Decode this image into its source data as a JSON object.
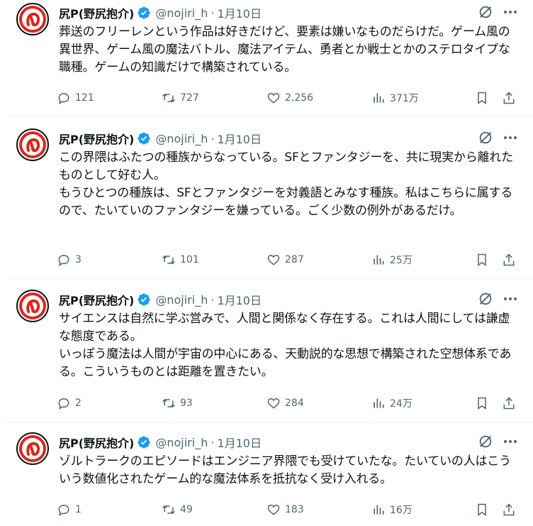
{
  "colors": {
    "text": "#0f1419",
    "muted": "#536471",
    "verified": "#1d9bf0",
    "avatar_red": "#e0251b",
    "divider": "#eff3f4"
  },
  "tweets": [
    {
      "name": "尻P(野尻抱介)",
      "handle": "@nojiri_h",
      "dot": "·",
      "date": "1月10日",
      "text": "葬送のフリーレンという作品は好きだけど、要素は嫌いなものだらけだ。ゲーム風の異世界、ゲーム風の魔法バトル、魔法アイテム、勇者とか戦士とかのステロタイプな職種。ゲームの知識だけで構築されている。",
      "replies": "121",
      "retweets": "727",
      "likes": "2,256",
      "views": "371万"
    },
    {
      "name": "尻P(野尻抱介)",
      "handle": "@nojiri_h",
      "dot": "·",
      "date": "1月10日",
      "text": "この界隈はふたつの種族からなっている。SFとファンタジーを、共に現実から離れたものとして好む人。\nもうひとつの種族は、SFとファンタジーを対義語とみなす種族。私はこちらに属するので、たいていのファンタジーを嫌っている。ごく少数の例外があるだけ。",
      "replies": "3",
      "retweets": "101",
      "likes": "287",
      "views": "25万"
    },
    {
      "name": "尻P(野尻抱介)",
      "handle": "@nojiri_h",
      "dot": "·",
      "date": "1月10日",
      "text": "サイエンスは自然に学ぶ営みで、人間と関係なく存在する。これは人間にしては謙虚な態度である。\nいっぽう魔法は人間が宇宙の中心にある、天動説的な思想で構築された空想体系である。こういうものとは距離を置きたい。",
      "replies": "2",
      "retweets": "93",
      "likes": "284",
      "views": "24万"
    },
    {
      "name": "尻P(野尻抱介)",
      "handle": "@nojiri_h",
      "dot": "·",
      "date": "1月10日",
      "text": "ゾルトラークのエピソードはエンジニア界隈でも受けていたな。たいていの人はこういう数値化されたゲーム的な魔法体系を抵抗なく受け入れる。",
      "replies": "1",
      "retweets": "49",
      "likes": "183",
      "views": "16万"
    }
  ]
}
